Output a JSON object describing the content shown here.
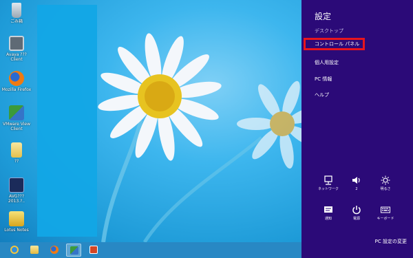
{
  "desktop": {
    "icons": [
      {
        "icon": "recycle-bin-icon",
        "label": "ごみ箱"
      },
      {
        "icon": "avaya-client-icon",
        "label": "Avaya ??? Client"
      },
      {
        "icon": "firefox-icon",
        "label": "Mozilla Firefox"
      },
      {
        "icon": "vmware-client-icon",
        "label": "VMware View Client"
      },
      {
        "icon": "folder-icon",
        "label": "??"
      },
      {
        "icon": "app-shortcut-icon",
        "label": "AVG??? 2013.?.."
      },
      {
        "icon": "app-shortcut-icon",
        "label": "Lotus Notes"
      }
    ]
  },
  "taskbar": {
    "buttons": [
      {
        "icon": "internet-explorer-icon"
      },
      {
        "icon": "file-explorer-icon"
      },
      {
        "icon": "firefox-icon"
      },
      {
        "icon": "network-app-icon",
        "active": true
      },
      {
        "icon": "powerpoint-icon"
      }
    ]
  },
  "charm": {
    "title": "設定",
    "subtitle": "デスクトップ",
    "items": [
      {
        "label": "コントロール パネル",
        "highlighted": true
      },
      {
        "label": "個人用設定"
      },
      {
        "label": "PC 情報"
      },
      {
        "label": "ヘルプ"
      }
    ],
    "quick_settings": [
      {
        "icon": "network-icon",
        "label": "ネットワーク"
      },
      {
        "icon": "volume-icon",
        "label": "2"
      },
      {
        "icon": "brightness-icon",
        "label": "明るさ"
      },
      {
        "icon": "notifications-icon",
        "label": "通知"
      },
      {
        "icon": "power-icon",
        "label": "電源"
      },
      {
        "icon": "keyboard-icon",
        "label": "キーボード"
      }
    ],
    "change_pc_settings": "PC 設定の変更",
    "accent_color": "#2b0a78",
    "highlight_color": "#e8151d"
  }
}
